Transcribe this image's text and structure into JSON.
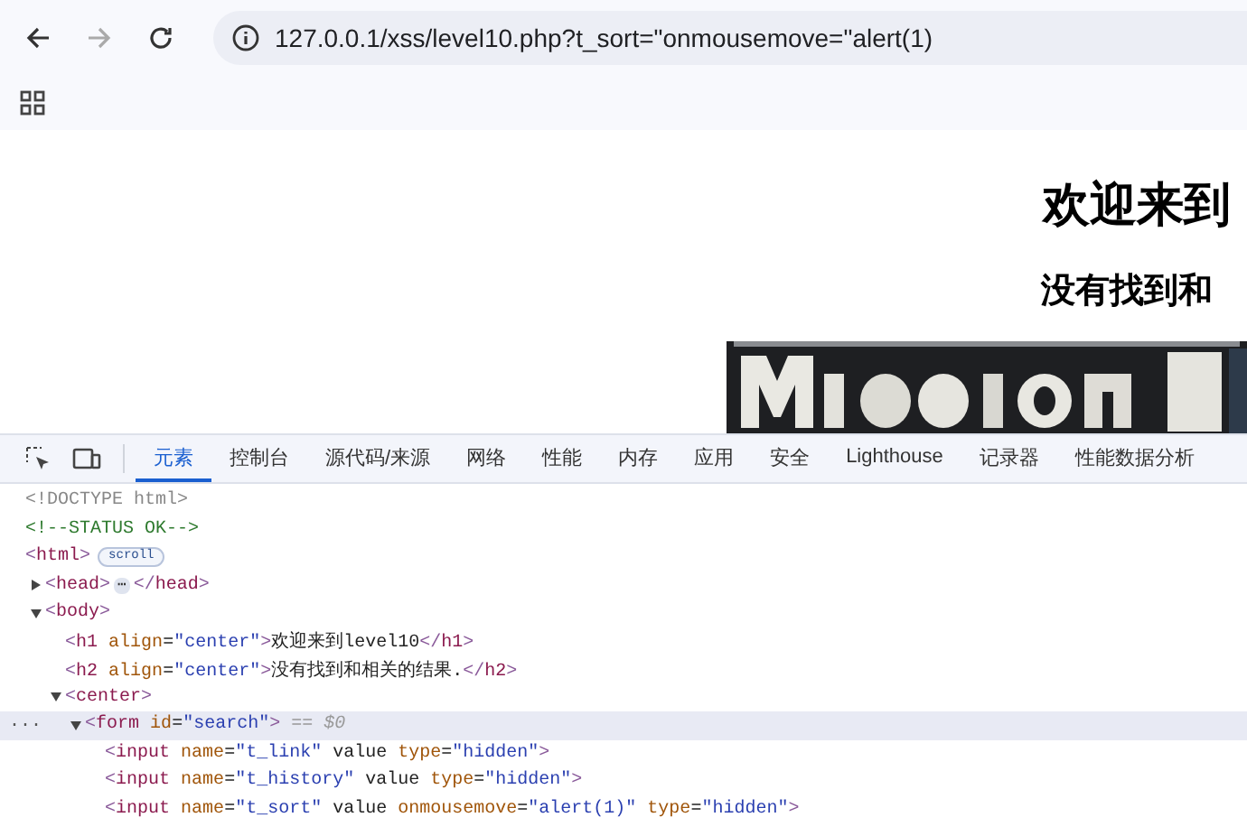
{
  "browser": {
    "address": "127.0.0.1/xss/level10.php?t_sort=\"onmousemove=\"alert(1)"
  },
  "page": {
    "heading": "欢迎来到",
    "subheading": "没有找到和"
  },
  "devtools": {
    "tabs": [
      {
        "label": "元素",
        "selected": true
      },
      {
        "label": "控制台",
        "selected": false
      },
      {
        "label": "源代码/来源",
        "selected": false
      },
      {
        "label": "网络",
        "selected": false
      },
      {
        "label": "性能",
        "selected": false
      },
      {
        "label": "内存",
        "selected": false
      },
      {
        "label": "应用",
        "selected": false
      },
      {
        "label": "安全",
        "selected": false
      },
      {
        "label": "Lighthouse",
        "selected": false
      },
      {
        "label": "记录器",
        "selected": false
      },
      {
        "label": "性能数据分析",
        "selected": false
      }
    ],
    "dom": [
      {
        "kind": "doctype",
        "markup": "<!DOCTYPE html>",
        "selected": false
      },
      {
        "kind": "comment",
        "markup": "<!--STATUS OK-->",
        "selected": false
      },
      {
        "kind": "element",
        "markup": "<html>",
        "badge": "scroll",
        "selected": false,
        "children": [
          {
            "kind": "element",
            "markup": "<head>",
            "expanded": false,
            "ellipsis": "⋯",
            "closing": "</head>",
            "selected": false
          },
          {
            "kind": "element",
            "markup": "<body>",
            "expanded": true,
            "selected": false,
            "children": [
              {
                "kind": "element",
                "markup": "<h1 align=\"center\">欢迎来到level10</h1>",
                "selected": false
              },
              {
                "kind": "element",
                "markup": "<h2 align=\"center\">没有找到和相关的结果.</h2>",
                "selected": false
              },
              {
                "kind": "element",
                "markup": "<center>",
                "expanded": true,
                "selected": false,
                "children": [
                  {
                    "kind": "element",
                    "markup": "<form id=\"search\">",
                    "expanded": true,
                    "selected": true,
                    "gutter": "...",
                    "suffix": "== $0",
                    "children": [
                      {
                        "kind": "element",
                        "markup": "<input name=\"t_link\" value type=\"hidden\">",
                        "selected": false
                      },
                      {
                        "kind": "element",
                        "markup": "<input name=\"t_history\" value type=\"hidden\">",
                        "selected": false
                      },
                      {
                        "kind": "element",
                        "markup": "<input name=\"t_sort\" value onmousemove=\"alert(1)\" type=\"hidden\">",
                        "selected": false
                      }
                    ]
                  }
                ]
              }
            ]
          }
        ]
      }
    ]
  }
}
